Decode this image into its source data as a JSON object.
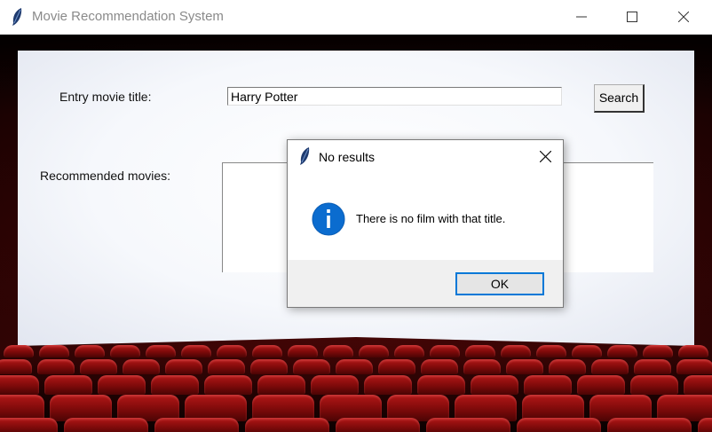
{
  "window": {
    "title": "Movie Recommendation System",
    "icons": {
      "app": "feather-icon",
      "minimize": "minimize-icon",
      "maximize": "maximize-icon",
      "close": "close-icon"
    }
  },
  "form": {
    "entry_label": "Entry movie title:",
    "entry_value": "Harry Potter",
    "search_label": "Search",
    "recommended_label": "Recommended movies:",
    "recommended_text": ""
  },
  "dialog": {
    "title": "No results",
    "message": "There is no film with that title.",
    "ok_label": "OK",
    "icons": {
      "app": "feather-icon",
      "info": "info-icon",
      "close": "close-icon"
    },
    "colors": {
      "info": "#0b6ccf",
      "focus": "#0078d7"
    }
  },
  "colors": {
    "seat": "#9e1010",
    "screen": "#f4f6fb"
  }
}
